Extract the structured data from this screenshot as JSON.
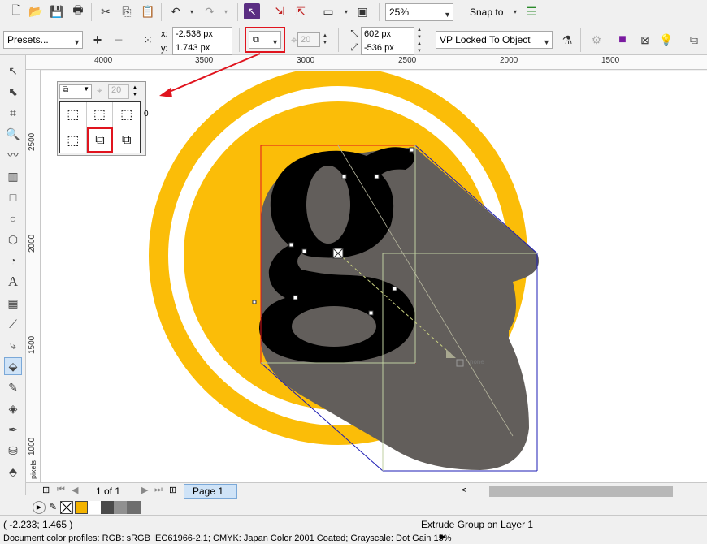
{
  "toolbar": {
    "zoom_value": "25%",
    "snap_to_label": "Snap to"
  },
  "property_bar": {
    "presets_label": "Presets...",
    "x_label": "x:",
    "x_value": "-2.538 px",
    "y_label": "y:",
    "y_value": "1.743 px",
    "depth_value": "20",
    "vp_x_value": "602 px",
    "vp_y_value": "-536 px",
    "vp_mode": "VP Locked To Object"
  },
  "ruler": {
    "top_labels": [
      "4000",
      "3500",
      "3000",
      "2500",
      "2000",
      "1500"
    ],
    "left_labels": [
      "2500",
      "2000",
      "1500",
      "1000"
    ],
    "unit": "pixels"
  },
  "flyout": {
    "depth_value": "20",
    "ruler_hint": "0"
  },
  "canvas": {
    "vp_label": "none",
    "colors": {
      "ring": "#fbbd08",
      "letter": "#000000",
      "extrusion": "#625e5b",
      "bbox_red": "#e0141e",
      "bbox_blue": "#1c1cb4",
      "arrow": "#e0141e"
    }
  },
  "page_nav": {
    "page_count": "1 of 1",
    "page_tab": "Page 1"
  },
  "palette": {
    "swatches": [
      "#f3b300",
      "#ffffff",
      "#4a4a4a",
      "#909090",
      "#6e6e6e"
    ]
  },
  "status": {
    "cursor_coords": "( -2.233; 1.465 )",
    "selection_info": "Extrude Group on Layer 1",
    "color_profiles": "Document color profiles: RGB: sRGB IEC61966-2.1; CMYK: Japan Color 2001 Coated; Grayscale: Dot Gain 15%"
  }
}
